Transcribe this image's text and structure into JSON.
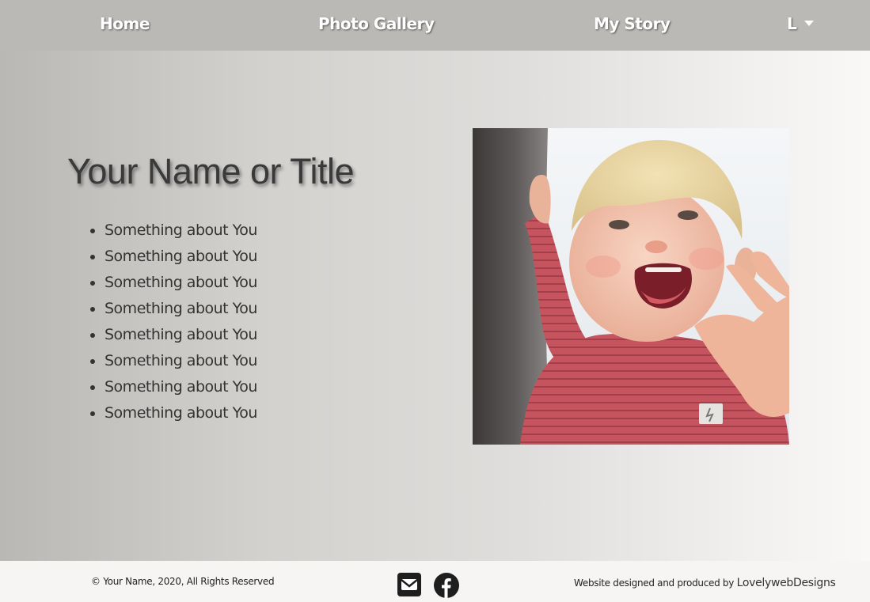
{
  "nav": {
    "home": "Home",
    "gallery": "Photo Gallery",
    "story": "My Story",
    "dropdown": "L"
  },
  "main": {
    "title": "Your Name or Title",
    "items": [
      "Something about You",
      "Something about You",
      "Something about You",
      "Something about You",
      "Something about You",
      "Something about You",
      "Something about You",
      "Something about You"
    ]
  },
  "footer": {
    "copyright": "© Your Name, 2020, All Rights Reserved",
    "credit_prefix": "Website designed and produced by",
    "credit_link": "LovelywebDesigns",
    "icons": [
      "envelope-icon",
      "facebook-icon"
    ]
  },
  "colors": {
    "nav_bg": "#bab9b6",
    "footer_bg": "#f6f5f3",
    "title_text": "#3a3a3a"
  }
}
